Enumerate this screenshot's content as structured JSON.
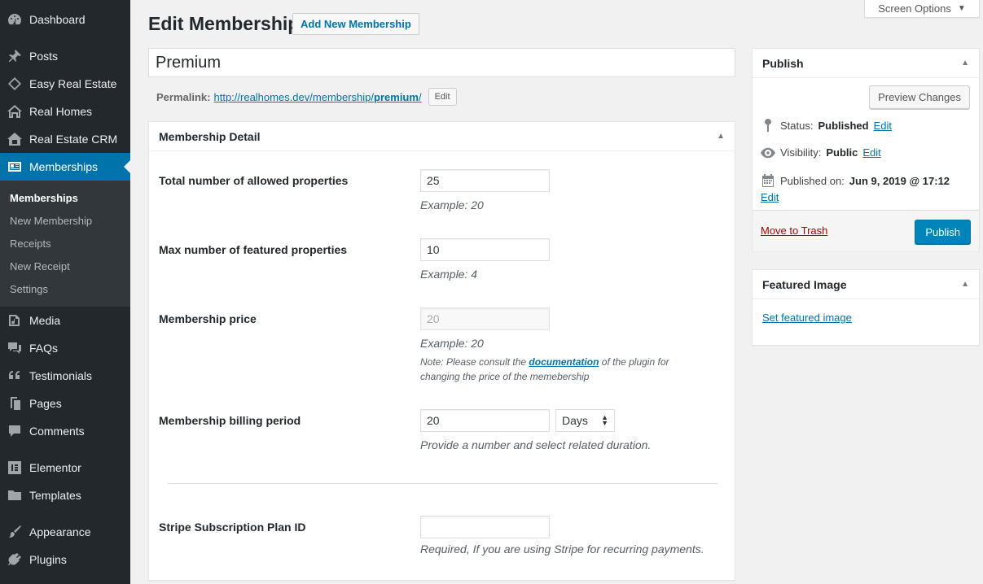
{
  "sidebar": {
    "items": [
      {
        "label": "Dashboard",
        "icon": "dashboard-icon"
      },
      {
        "label": "Posts",
        "icon": "pin-icon"
      },
      {
        "label": "Easy Real Estate",
        "icon": "tag-icon"
      },
      {
        "label": "Real Homes",
        "icon": "house-icon"
      },
      {
        "label": "Real Estate CRM",
        "icon": "house-icon"
      },
      {
        "label": "Memberships",
        "icon": "id-card-icon"
      },
      {
        "label": "Media",
        "icon": "media-icon"
      },
      {
        "label": "FAQs",
        "icon": "comment-icon"
      },
      {
        "label": "Testimonials",
        "icon": "quote-icon"
      },
      {
        "label": "Pages",
        "icon": "pages-icon"
      },
      {
        "label": "Comments",
        "icon": "comment-icon"
      },
      {
        "label": "Elementor",
        "icon": "elementor-icon"
      },
      {
        "label": "Templates",
        "icon": "folder-icon"
      },
      {
        "label": "Appearance",
        "icon": "brush-icon"
      },
      {
        "label": "Plugins",
        "icon": "plugin-icon"
      }
    ],
    "submenu": [
      "Memberships",
      "New Membership",
      "Receipts",
      "New Receipt",
      "Settings"
    ]
  },
  "screen_options": "Screen Options",
  "header": {
    "title": "Edit Membership",
    "add_new": "Add New Membership"
  },
  "post_title": "Premium",
  "permalink": {
    "label": "Permalink:",
    "url_base": "http://realhomes.dev/membership/",
    "slug": "premium",
    "url_end": "/",
    "edit": "Edit"
  },
  "membership_box": {
    "title": "Membership Detail",
    "fields": {
      "allowed_properties": {
        "label": "Total number of allowed properties",
        "value": "25",
        "help": "Example: 20"
      },
      "featured_properties": {
        "label": "Max number of featured properties",
        "value": "10",
        "help": "Example: 4"
      },
      "price": {
        "label": "Membership price",
        "value": "20",
        "help": "Example: 20",
        "note_before": "Note: Please consult the",
        "note_link": "documentation",
        "note_after": "of the plugin for changing the price of the memebership"
      },
      "billing_period": {
        "label": "Membership billing period",
        "value": "20",
        "duration": "Days",
        "help": "Provide a number and select related duration."
      },
      "stripe_plan": {
        "label": "Stripe Subscription Plan ID",
        "value": "",
        "help": "Required, If you are using Stripe for recurring payments."
      }
    }
  },
  "publish_box": {
    "title": "Publish",
    "preview": "Preview Changes",
    "status_label": "Status:",
    "status_value": "Published",
    "visibility_label": "Visibility:",
    "visibility_value": "Public",
    "published_label": "Published on:",
    "published_value": "Jun 9, 2019 @ 17:12",
    "edit": "Edit",
    "trash": "Move to Trash",
    "publish": "Publish"
  },
  "featured_box": {
    "title": "Featured Image",
    "link": "Set featured image"
  },
  "colors": {
    "sidebar_bg": "#23282d",
    "submenu_bg": "#32373c",
    "accent": "#0073aa",
    "publish_button": "#0085ba",
    "trash": "#aa0000"
  }
}
